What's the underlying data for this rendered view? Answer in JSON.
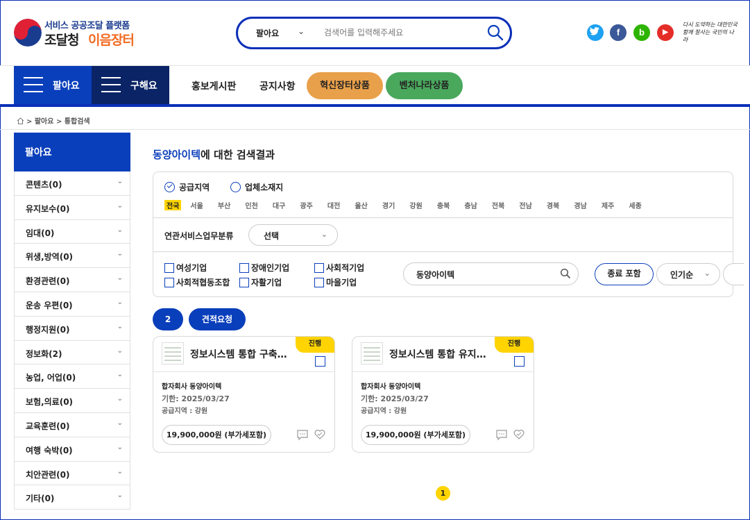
{
  "brand": {
    "sub_title": "서비스 공공조달 플랫폼",
    "name_part1": "조달청",
    "name_part2": "이음장터"
  },
  "search": {
    "category": "팔아요",
    "placeholder": "검색어를 입력해주세요"
  },
  "social": [
    {
      "name": "twitter",
      "glyph": "t",
      "color": "#1da1f2"
    },
    {
      "name": "facebook",
      "glyph": "f",
      "color": "#3b5998"
    },
    {
      "name": "blog",
      "glyph": "b",
      "color": "#2db400"
    },
    {
      "name": "youtube",
      "glyph": "▶",
      "color": "#e52d27"
    }
  ],
  "slogan": "다시 도약하는 대한민국 함께 잘사는 국민의 나라",
  "nav": {
    "sell": "팔아요",
    "buy": "구해요",
    "board": "홍보게시판",
    "notice": "공지사항",
    "innovation": "혁신장터상품",
    "venture": "벤처나라상품"
  },
  "breadcrumb": "> 팔아요 > 통합검색",
  "sidebar": {
    "title": "팔아요",
    "items": [
      "콘텐츠(0)",
      "유지보수(0)",
      "임대(0)",
      "위생,방역(0)",
      "환경관련(0)",
      "운송 우편(0)",
      "행정지원(0)",
      "정보화(2)",
      "농업, 어업(0)",
      "보험,의료(0)",
      "교육훈련(0)",
      "여행 숙박(0)",
      "치안관련(0)",
      "기타(0)"
    ]
  },
  "results": {
    "keyword": "동양아이텍",
    "suffix": "에 대한 검색결과"
  },
  "filter": {
    "radio_supply": "공급지역",
    "radio_location": "업체소재지",
    "regions": [
      "전국",
      "서울",
      "부산",
      "인천",
      "대구",
      "광주",
      "대전",
      "울산",
      "경기",
      "강원",
      "충북",
      "충남",
      "전북",
      "전남",
      "경북",
      "경남",
      "제주",
      "세종"
    ],
    "category_label": "연관서비스업무분류",
    "category_select": "선택",
    "checkboxes": [
      "여성기업",
      "장애인기업",
      "사회적기업",
      "사회적협동조합",
      "자활기업",
      "마을기업"
    ],
    "keyword_value": "동양아이텍",
    "include_ended": "종료 포함",
    "sort": "인기순"
  },
  "actions": {
    "count": "2",
    "quote": "견적요청"
  },
  "cards": [
    {
      "title": "정보시스템 통합 구축사업",
      "badge": "진행",
      "company": "합자회사 동양아이텍",
      "deadline": "기한: 2025/03/27",
      "region": "공급지역 : 강원",
      "price": "19,900,000원 (부가세포함)"
    },
    {
      "title": "정보시스템 통합 유지보수",
      "badge": "진행",
      "company": "합자회사 동양아이텍",
      "deadline": "기한: 2025/03/27",
      "region": "공급지역 : 강원",
      "price": "19,900,000원 (부가세포함)"
    }
  ],
  "pagination": {
    "current": "1"
  },
  "colors": {
    "primary": "#0a3fbb",
    "navy": "#0b2466",
    "accent_yellow": "#ffd400",
    "orange": "#e9a04a",
    "green": "#4aa85d"
  }
}
